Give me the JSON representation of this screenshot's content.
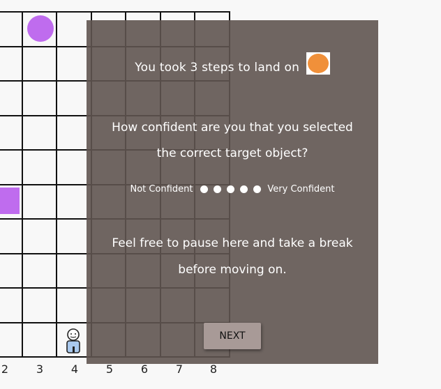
{
  "game": {
    "axis_labels": [
      "2",
      "3",
      "4",
      "5",
      "6",
      "7",
      "8"
    ],
    "colors": {
      "purple": "#bf6cee",
      "orange": "#f0903a",
      "overlay": "#5f5450"
    }
  },
  "modal": {
    "steps_text": "You took 3 steps to land on",
    "target_icon": "orange-circle",
    "question_line1": "How confident are you that you selected",
    "question_line2": "the correct target object?",
    "scale_left": "Not Confident",
    "scale_right": "Very Confident",
    "scale_points": 5,
    "note_line1": "Feel free to pause here and take a break",
    "note_line2": "before moving on.",
    "next_label": "NEXT"
  }
}
